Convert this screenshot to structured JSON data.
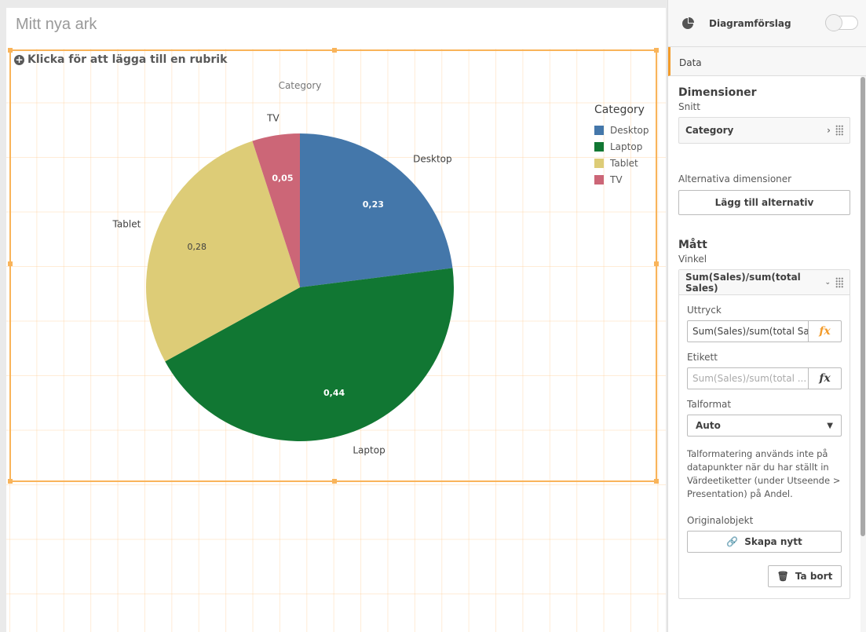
{
  "sheet": {
    "title": "Mitt nya ark"
  },
  "chart": {
    "add_title": "Klicka för att lägga till en rubrik"
  },
  "chart_data": {
    "type": "pie",
    "title": "Category",
    "categories": [
      "Desktop",
      "Laptop",
      "Tablet",
      "TV"
    ],
    "values": [
      0.23,
      0.44,
      0.28,
      0.05
    ],
    "value_labels": [
      "0,23",
      "0,44",
      "0,28",
      "0,05"
    ],
    "colors": [
      "#4477aa",
      "#117733",
      "#ddcc77",
      "#cc6677"
    ],
    "legend": {
      "title": "Category",
      "placement": "top-right"
    }
  },
  "panel": {
    "suggestions_label": "Diagramförslag",
    "tab": "Data",
    "dimensions": {
      "heading": "Dimensioner",
      "sub": "Snitt",
      "item": "Category",
      "alt_label": "Alternativa dimensioner",
      "add_alt": "Lägg till alternativ"
    },
    "measures": {
      "heading": "Mått",
      "sub": "Vinkel",
      "item": "Sum(Sales)/sum(total Sales)",
      "expr_label": "Uttryck",
      "expr_value": "Sum(Sales)/sum(total Sa",
      "label_label": "Etikett",
      "label_placeholder": "Sum(Sales)/sum(total ...",
      "fx": "fx",
      "format_label": "Talformat",
      "format_value": "Auto",
      "note": "Talformatering används inte på datapunkter när du har ställt in Värdeetiketter (under Utseende > Presentation) på Andel.",
      "original_label": "Originalobjekt",
      "create_new": "Skapa nytt",
      "delete": "Ta bort"
    }
  }
}
